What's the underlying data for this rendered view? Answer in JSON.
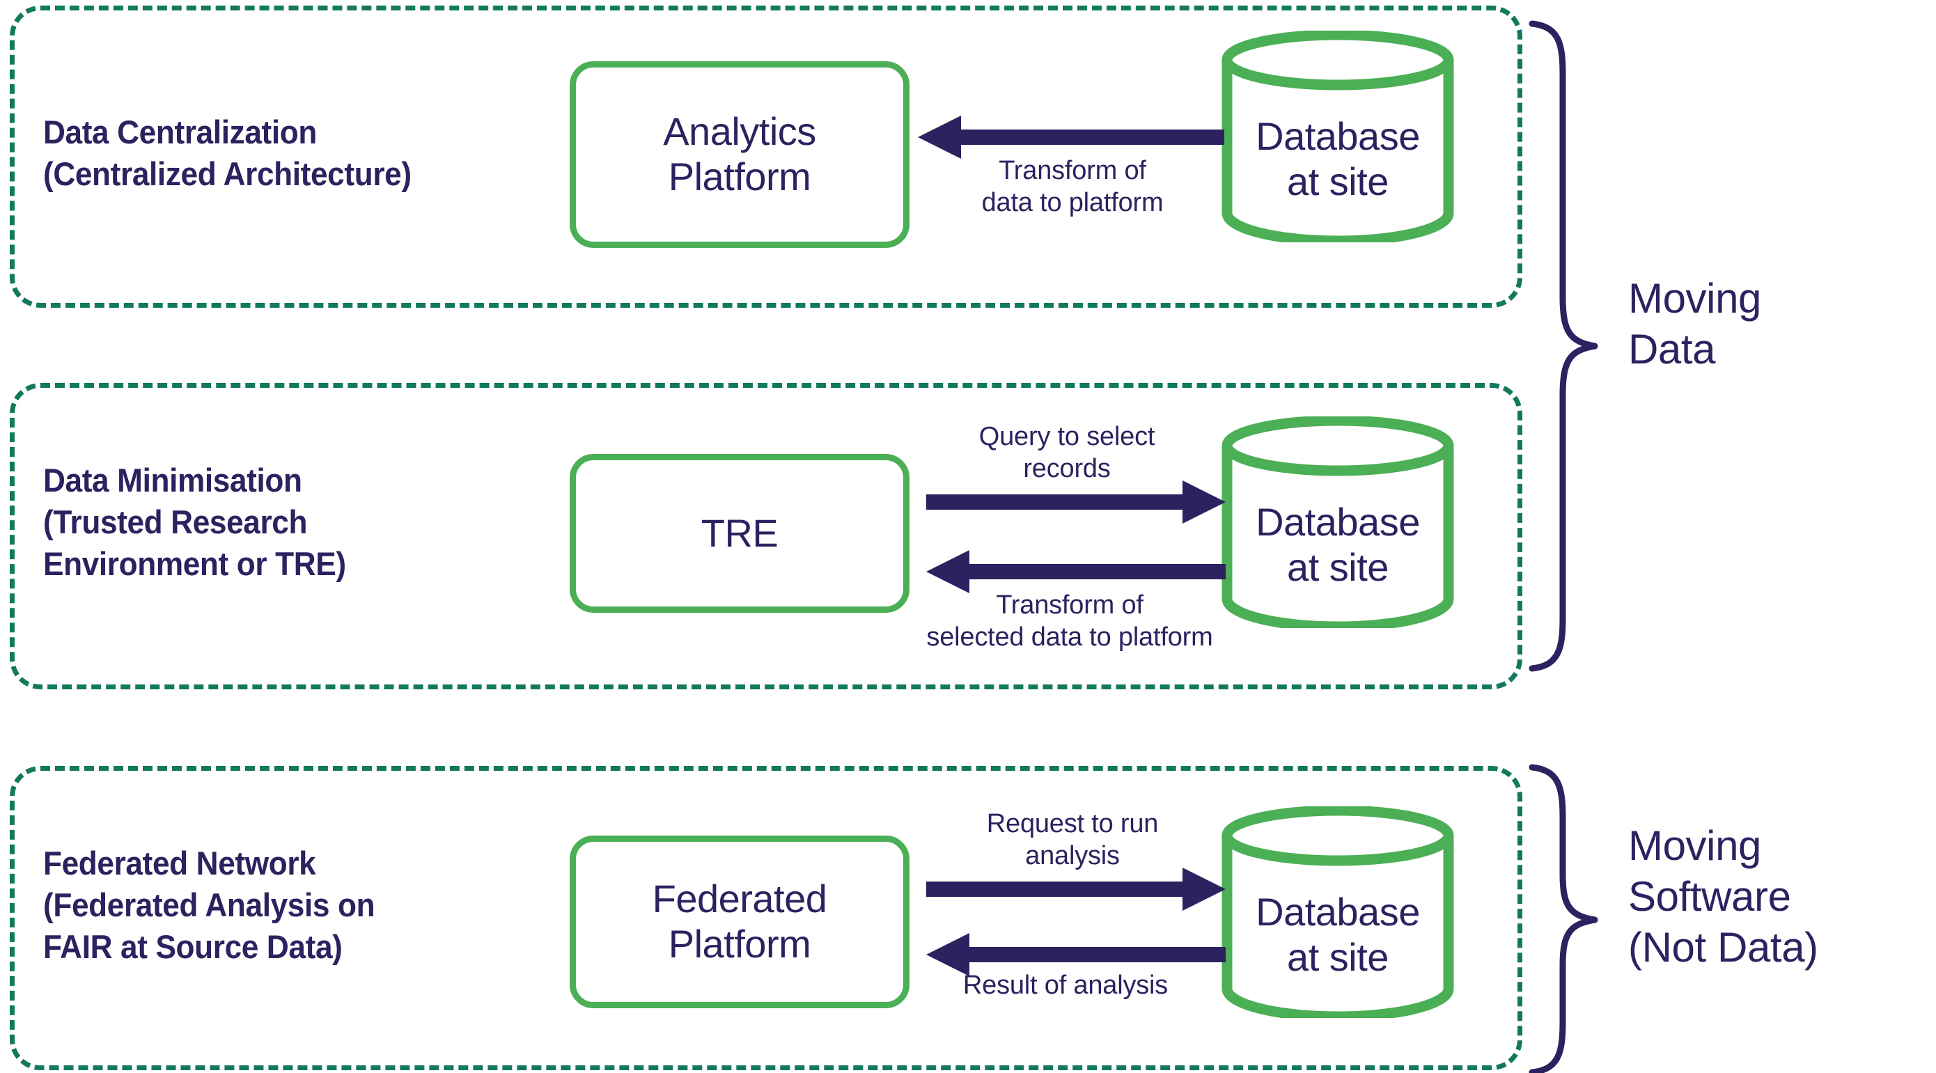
{
  "colors": {
    "purple": "#2E2160",
    "green": "#4BAF55",
    "dashed_green": "#12795E",
    "background": "#FFFFFF"
  },
  "rows": [
    {
      "caption": "Data Centralization\n(Centralized Architecture)",
      "platform_label": "Analytics\nPlatform",
      "database_label": "Database\nat site",
      "arrows": [
        {
          "direction": "left",
          "caption": "Transform of\ndata to platform"
        }
      ]
    },
    {
      "caption": "Data Minimisation\n(Trusted Research\nEnvironment or TRE)",
      "platform_label": "TRE",
      "database_label": "Database\nat site",
      "arrows": [
        {
          "direction": "right",
          "caption": "Query to select\nrecords"
        },
        {
          "direction": "left",
          "caption": "Transform of\nselected data to platform"
        }
      ]
    },
    {
      "caption": "Federated Network\n(Federated Analysis on\nFAIR at Source Data)",
      "platform_label": "Federated\nPlatform",
      "database_label": "Database\nat site",
      "arrows": [
        {
          "direction": "right",
          "caption": "Request to run\nanalysis"
        },
        {
          "direction": "left",
          "caption": "Result of analysis"
        }
      ]
    }
  ],
  "groups": [
    {
      "title": "Moving\nData",
      "spans_rows": [
        1,
        2
      ]
    },
    {
      "title": "Moving\nSoftware\n(Not Data)",
      "spans_rows": [
        3
      ]
    }
  ]
}
